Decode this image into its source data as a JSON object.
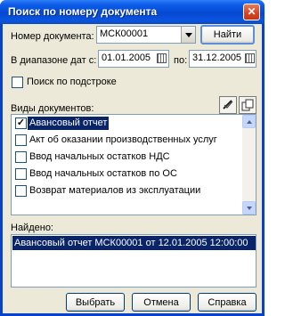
{
  "window": {
    "title": "Поиск по номеру документа",
    "close_glyph": "✕"
  },
  "doc_number": {
    "label": "Номер документа:",
    "value": "МСК00001"
  },
  "find_button": "Найти",
  "date_range": {
    "label": "В диапазоне дат с:",
    "from": "01.01.2005",
    "to_label": "по:",
    "to": "31.12.2005"
  },
  "substring_search": {
    "label": "Поиск по подстроке",
    "checked": false
  },
  "doc_types": {
    "label": "Виды документов:",
    "items": [
      {
        "label": "Авансовый отчет",
        "checked": true,
        "selected": true
      },
      {
        "label": "Акт об оказании производственных услуг",
        "checked": false
      },
      {
        "label": "Ввод начальных остатков НДС",
        "checked": false
      },
      {
        "label": "Ввод начальных остатков по ОС",
        "checked": false
      },
      {
        "label": "Возврат материалов из эксплуатации",
        "checked": false
      }
    ]
  },
  "found": {
    "label": "Найдено:",
    "results": [
      "Авансовый отчет МСК00001 от 12.01.2005 12:00:00"
    ]
  },
  "buttons": {
    "select": "Выбрать",
    "cancel": "Отмена",
    "help": "Справка"
  },
  "icons": {
    "calendar": "calendar-icon",
    "check_all": "check-all-icon",
    "copy": "copy-icon"
  }
}
